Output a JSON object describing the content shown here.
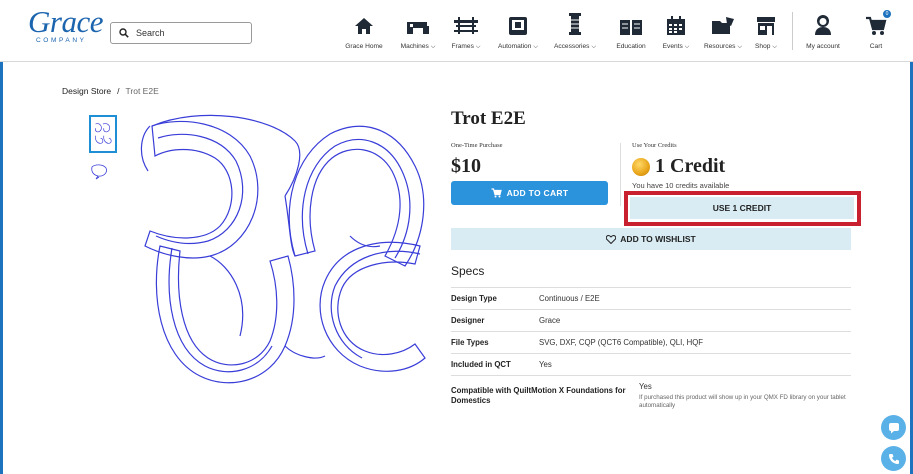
{
  "brand": {
    "logo_text": "Grace",
    "logo_sub": "COMPANY",
    "accent": "#1e73be",
    "highlight": "#c8202f"
  },
  "search": {
    "placeholder": "Search"
  },
  "nav": {
    "items": [
      {
        "label": "Grace Home",
        "icon": "home-icon",
        "dropdown": false
      },
      {
        "label": "Machines",
        "icon": "sewing-machine-icon",
        "dropdown": true
      },
      {
        "label": "Frames",
        "icon": "quilting-frame-icon",
        "dropdown": true
      },
      {
        "label": "Automation",
        "icon": "automation-screen-icon",
        "dropdown": true
      },
      {
        "label": "Accessories",
        "icon": "thread-spool-icon",
        "dropdown": true
      },
      {
        "label": "Education",
        "icon": "book-icon",
        "dropdown": false
      },
      {
        "label": "Events",
        "icon": "calendar-icon",
        "dropdown": true
      },
      {
        "label": "Resources",
        "icon": "folder-icon",
        "dropdown": true
      },
      {
        "label": "Shop",
        "icon": "storefront-icon",
        "dropdown": true
      },
      {
        "label": "My account",
        "icon": "user-icon",
        "dropdown": false
      },
      {
        "label": "Cart",
        "icon": "cart-icon",
        "dropdown": false
      }
    ],
    "cart_badge": "0"
  },
  "breadcrumb": {
    "parent": "Design Store",
    "separator": "/",
    "current": "Trot E2E"
  },
  "product": {
    "title": "Trot E2E",
    "one_time_label": "One-Time Purchase",
    "price": "$10",
    "add_to_cart": "ADD TO CART",
    "credits_label": "Use Your Credits",
    "credit_value": "1 Credit",
    "credits_available": "You have 10 credits available",
    "use_credit": "USE 1 CREDIT",
    "wishlist": "ADD TO WISHLIST"
  },
  "specs": {
    "title": "Specs",
    "rows": [
      {
        "key": "Design Type",
        "value": "Continuous / E2E"
      },
      {
        "key": "Designer",
        "value": "Grace"
      },
      {
        "key": "File Types",
        "value": "SVG, DXF, CQP (QCT6 Compatible), QLI, HQF"
      },
      {
        "key": "Included in QCT",
        "value": "Yes"
      },
      {
        "key": "Compatible with QuiltMotion X Foundations for Domestics",
        "value": "Yes",
        "note": "If purchased this product will show up in your QMX FD library on your tablet automatically"
      }
    ]
  }
}
